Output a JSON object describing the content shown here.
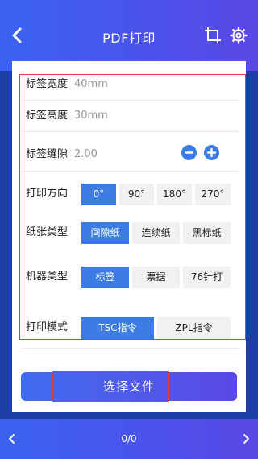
{
  "header": {
    "title": "PDF打印"
  },
  "settings": {
    "width": {
      "label": "标签宽度",
      "value": "40mm"
    },
    "height": {
      "label": "标签高度",
      "value": "30mm"
    },
    "gap": {
      "label": "标签缝隙",
      "value": "2.00"
    },
    "direction": {
      "label": "打印方向",
      "options": [
        "0°",
        "90°",
        "180°",
        "270°"
      ],
      "selected": "0°"
    },
    "paper": {
      "label": "纸张类型",
      "options": [
        "间隙纸",
        "连续纸",
        "黑标纸"
      ],
      "selected": "间隙纸"
    },
    "machine": {
      "label": "机器类型",
      "options": [
        "标签",
        "票据",
        "76针打"
      ],
      "selected": "标签"
    },
    "mode": {
      "label": "打印模式",
      "options": [
        "TSC指令",
        "ZPL指令"
      ],
      "selected": "TSC指令"
    }
  },
  "select_file_label": "选择文件",
  "footer": {
    "page_indicator": "0/0"
  },
  "colors": {
    "accent": "#3d7ce5",
    "header_start": "#3a63ef",
    "header_end": "#5a48e6",
    "highlight_outline": "#e23b3b"
  }
}
